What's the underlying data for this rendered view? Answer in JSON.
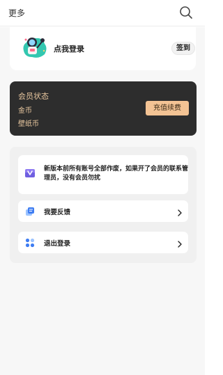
{
  "header": {
    "title": "更多",
    "search_icon": "search-icon"
  },
  "login_card": {
    "login_label": "点我登录",
    "signin_label": "签到",
    "avatar_icon": "astronaut-avatar-icon"
  },
  "vip_card": {
    "status_label": "会员状态",
    "coin_label": "金币",
    "wallpaper_coin_label": "壁纸币",
    "recharge_label": "充值续费",
    "accent_color": "#e9c8a0",
    "button_color": "#f3c394"
  },
  "notice": {
    "text": "新版本前所有账号全部作废，如果开了会员的联系管理员，没有会员勿扰",
    "icon": "vip-v-icon"
  },
  "menu": [
    {
      "label": "我要反馈",
      "icon": "feedback-icon"
    },
    {
      "label": "退出登录",
      "icon": "logout-icon"
    }
  ]
}
